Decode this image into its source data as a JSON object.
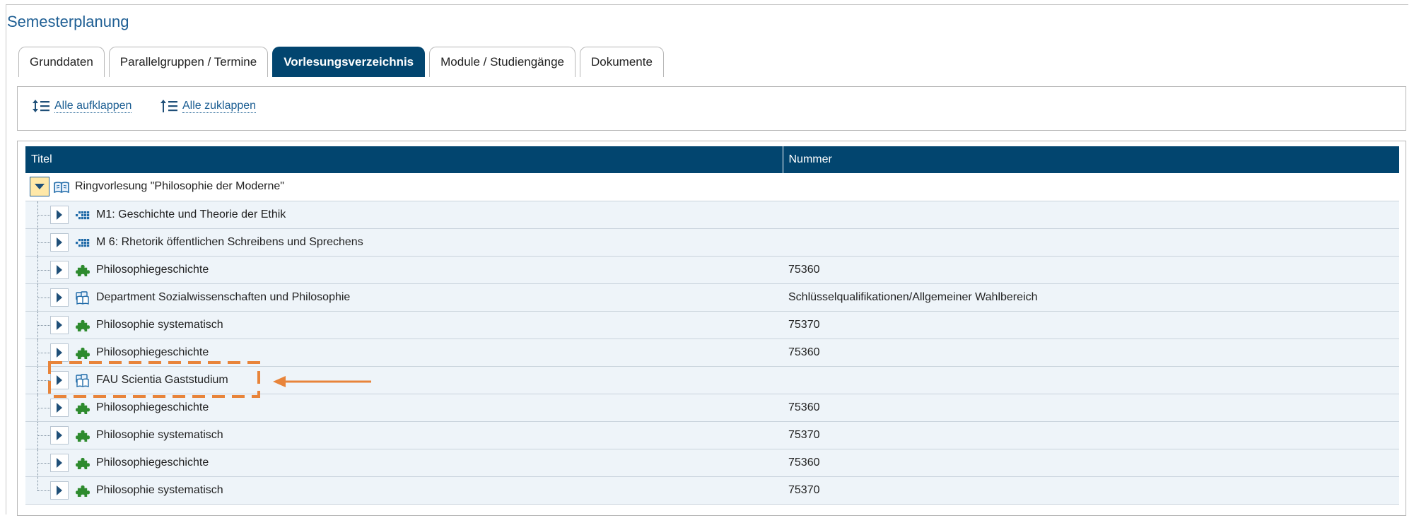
{
  "page": {
    "title": "Semesterplanung"
  },
  "tabs": [
    {
      "label": "Grunddaten",
      "active": false
    },
    {
      "label": "Parallelgruppen / Termine",
      "active": false
    },
    {
      "label": "Vorlesungsverzeichnis",
      "active": true
    },
    {
      "label": "Module / Studiengänge",
      "active": false
    },
    {
      "label": "Dokumente",
      "active": false
    }
  ],
  "toolbar": {
    "expand_all_label": "Alle aufklappen",
    "collapse_all_label": "Alle zuklappen"
  },
  "tree": {
    "columns": {
      "title": "Titel",
      "number": "Nummer"
    },
    "root": {
      "title": "Ringvorlesung \"Philosophie der Moderne\"",
      "number": "",
      "icon": "book-icon",
      "expanded": true
    },
    "rows": [
      {
        "title": "M1: Geschichte und Theorie der Ethik",
        "number": "",
        "icon": "module-dots-icon"
      },
      {
        "title": "M 6: Rhetorik öffentlichen Schreibens und Sprechens",
        "number": "",
        "icon": "module-dots-icon"
      },
      {
        "title": "Philosophiegeschichte",
        "number": "75360",
        "icon": "puzzle-icon"
      },
      {
        "title": "Department Sozialwissenschaften und Philosophie",
        "number": "Schlüsselqualifikationen/Allgemeiner Wahlbereich",
        "icon": "folder-book-icon"
      },
      {
        "title": "Philosophie systematisch",
        "number": "75370",
        "icon": "puzzle-icon"
      },
      {
        "title": "Philosophiegeschichte",
        "number": "75360",
        "icon": "puzzle-icon"
      },
      {
        "title": "FAU Scientia Gaststudium",
        "number": "",
        "icon": "folder-book-icon",
        "highlighted": true
      },
      {
        "title": "Philosophiegeschichte",
        "number": "75360",
        "icon": "puzzle-icon"
      },
      {
        "title": "Philosophie systematisch",
        "number": "75370",
        "icon": "puzzle-icon"
      },
      {
        "title": "Philosophiegeschichte",
        "number": "75360",
        "icon": "puzzle-icon"
      },
      {
        "title": "Philosophie systematisch",
        "number": "75370",
        "icon": "puzzle-icon"
      }
    ]
  },
  "colors": {
    "header_bg": "#02456f",
    "title_blue": "#1f5f94",
    "row_bg": "#eef4f9",
    "puzzle_green": "#2e8b2e",
    "annotation_orange": "#e8843a"
  }
}
